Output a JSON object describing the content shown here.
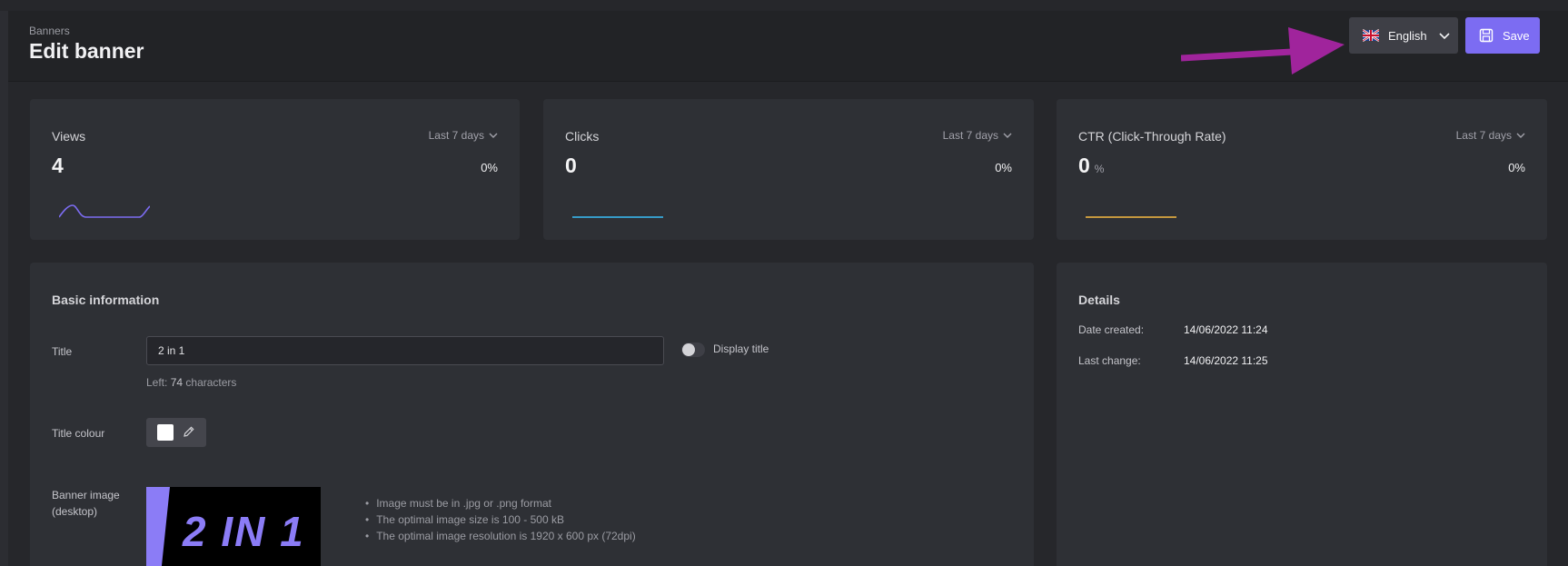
{
  "header": {
    "breadcrumb": "Banners",
    "title": "Edit banner",
    "language_label": "English",
    "save_label": "Save"
  },
  "stats": [
    {
      "title": "Views",
      "period": "Last 7 days",
      "value": "4",
      "unit": "",
      "change": "0%",
      "color": "#7c6cf2"
    },
    {
      "title": "Clicks",
      "period": "Last 7 days",
      "value": "0",
      "unit": "",
      "change": "0%",
      "color": "#38bdf8"
    },
    {
      "title": "CTR (Click-Through Rate)",
      "period": "Last 7 days",
      "value": "0",
      "unit": "%",
      "change": "0%",
      "color": "#f5b942"
    }
  ],
  "basic": {
    "section_title": "Basic information",
    "title_label": "Title",
    "title_value": "2 in 1",
    "display_title_label": "Display title",
    "display_title_on": false,
    "left_prefix": "Left:",
    "left_count": "74",
    "left_suffix": "characters",
    "title_colour_label": "Title colour",
    "title_colour_value": "#ffffff",
    "banner_image_label_1": "Banner image",
    "banner_image_label_2": "(desktop)",
    "banner_image_text": "2 IN 1",
    "hints": [
      "Image must be in .jpg or .png format",
      "The optimal image size is 100 - 500 kB",
      "The optimal image resolution is 1920 x 600 px (72dpi)"
    ]
  },
  "details": {
    "section_title": "Details",
    "date_created_label": "Date created:",
    "date_created_value": "14/06/2022 11:24",
    "last_change_label": "Last change:",
    "last_change_value": "14/06/2022 11:25"
  },
  "colors": {
    "accent": "#7c6cf2",
    "annotation_arrow": "#a0249c"
  }
}
